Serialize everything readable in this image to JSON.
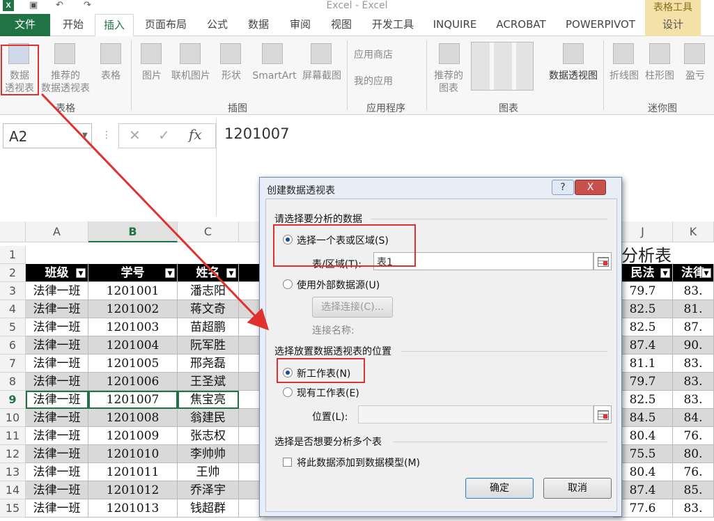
{
  "window": {
    "title": "Excel - Excel",
    "tool_tab_title": "表格工具"
  },
  "quick_access": {
    "save_icon": "save-icon",
    "undo_icon": "undo-icon",
    "redo_icon": "redo-icon"
  },
  "tabs": [
    "文件",
    "开始",
    "插入",
    "页面布局",
    "公式",
    "数据",
    "审阅",
    "视图",
    "开发工具",
    "INQUIRE",
    "ACROBAT",
    "POWERPIVOT",
    "设计"
  ],
  "active_tab": "插入",
  "ribbon": {
    "groups": {
      "tables": "表格",
      "illustrations": "插图",
      "apps": "应用程序",
      "charts": "图表",
      "sparklines": "迷你图"
    },
    "buttons": {
      "pivot_table": [
        "数据",
        "透视表"
      ],
      "recommended_pivot": [
        "推荐的",
        "数据透视表"
      ],
      "table": "表格",
      "pictures": "图片",
      "online_pictures": "联机图片",
      "shapes": "形状",
      "smartart": "SmartArt",
      "screenshot": "屏幕截图",
      "app_store": "应用商店",
      "my_apps": "我的应用",
      "recommended_charts": [
        "推荐的",
        "图表"
      ],
      "pivot_chart": "数据透视图",
      "line": "折线图",
      "column": "柱形图",
      "win_loss": "盈亏"
    }
  },
  "formula_bar": {
    "name_box": "A2",
    "fx": "fx",
    "value": "1201007"
  },
  "columns": [
    "A",
    "B",
    "C",
    "J",
    "K"
  ],
  "rows": [
    "1",
    "2",
    "3",
    "4",
    "5",
    "6",
    "7",
    "8",
    "9",
    "10",
    "11",
    "12",
    "13",
    "14",
    "15"
  ],
  "sheet": {
    "title_fragment": "分析表",
    "headers": [
      "班级",
      "学号",
      "姓名",
      "民法",
      "法律"
    ],
    "data": [
      [
        "法律一班",
        "1201001",
        "潘志阳",
        "79.7",
        "83."
      ],
      [
        "法律一班",
        "1201002",
        "蒋文奇",
        "82.5",
        "81."
      ],
      [
        "法律一班",
        "1201003",
        "苗超鹏",
        "82.5",
        "87."
      ],
      [
        "法律一班",
        "1201004",
        "阮军胜",
        "87.4",
        "90."
      ],
      [
        "法律一班",
        "1201005",
        "邢尧磊",
        "81.1",
        "83."
      ],
      [
        "法律一班",
        "1201006",
        "王圣斌",
        "79.7",
        "83."
      ],
      [
        "法律一班",
        "1201007",
        "焦宝亮",
        "82.5",
        "83."
      ],
      [
        "法律一班",
        "1201008",
        "翁建民",
        "84.5",
        "84."
      ],
      [
        "法律一班",
        "1201009",
        "张志权",
        "80.4",
        "76."
      ],
      [
        "法律一班",
        "1201010",
        "李帅帅",
        "75.5",
        "80."
      ],
      [
        "法律一班",
        "1201011",
        "王帅",
        "80.4",
        "76."
      ],
      [
        "法律一班",
        "1201012",
        "乔泽宇",
        "87.4",
        "85."
      ],
      [
        "法律一班",
        "1201013",
        "钱超群",
        "77.6",
        "83."
      ]
    ]
  },
  "dialog": {
    "title": "创建数据透视表",
    "help": "?",
    "close": "X",
    "section1": "请选择要分析的数据",
    "opt_range": "选择一个表或区域(S)",
    "range_label": "表/区域(T):",
    "range_value": "表1",
    "opt_external": "使用外部数据源(U)",
    "choose_conn": "选择连接(C)...",
    "conn_name_label": "连接名称:",
    "section2": "选择放置数据透视表的位置",
    "opt_new_sheet": "新工作表(N)",
    "opt_existing": "现有工作表(E)",
    "location_label": "位置(L):",
    "section3": "选择是否想要分析多个表",
    "add_model": "将此数据添加到数据模型(M)",
    "ok": "确定",
    "cancel": "取消"
  }
}
